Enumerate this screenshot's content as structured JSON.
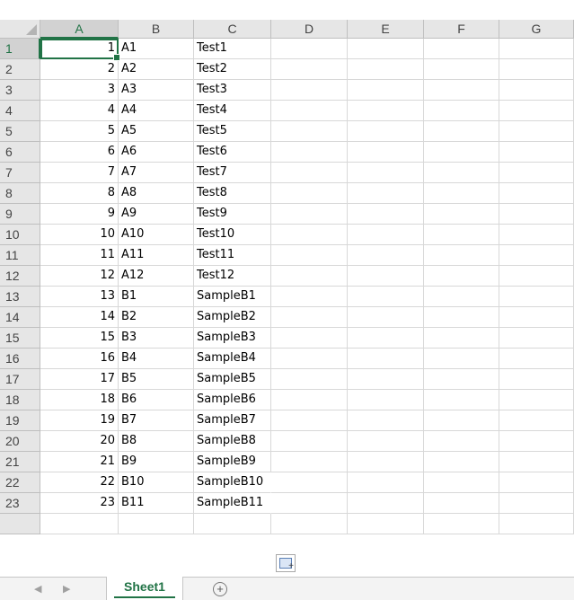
{
  "columns": [
    "A",
    "B",
    "C",
    "D",
    "E",
    "F",
    "G"
  ],
  "active_cell": "A1",
  "rows": [
    {
      "row": "1",
      "a": "1",
      "b": "A1",
      "c": "Test1"
    },
    {
      "row": "2",
      "a": "2",
      "b": "A2",
      "c": "Test2"
    },
    {
      "row": "3",
      "a": "3",
      "b": "A3",
      "c": "Test3"
    },
    {
      "row": "4",
      "a": "4",
      "b": "A4",
      "c": "Test4"
    },
    {
      "row": "5",
      "a": "5",
      "b": "A5",
      "c": "Test5"
    },
    {
      "row": "6",
      "a": "6",
      "b": "A6",
      "c": "Test6"
    },
    {
      "row": "7",
      "a": "7",
      "b": "A7",
      "c": "Test7"
    },
    {
      "row": "8",
      "a": "8",
      "b": "A8",
      "c": "Test8"
    },
    {
      "row": "9",
      "a": "9",
      "b": "A9",
      "c": "Test9"
    },
    {
      "row": "10",
      "a": "10",
      "b": "A10",
      "c": "Test10"
    },
    {
      "row": "11",
      "a": "11",
      "b": "A11",
      "c": "Test11"
    },
    {
      "row": "12",
      "a": "12",
      "b": "A12",
      "c": "Test12"
    },
    {
      "row": "13",
      "a": "13",
      "b": "B1",
      "c": "SampleB1"
    },
    {
      "row": "14",
      "a": "14",
      "b": "B2",
      "c": "SampleB2"
    },
    {
      "row": "15",
      "a": "15",
      "b": "B3",
      "c": "SampleB3"
    },
    {
      "row": "16",
      "a": "16",
      "b": "B4",
      "c": "SampleB4"
    },
    {
      "row": "17",
      "a": "17",
      "b": "B5",
      "c": "SampleB5"
    },
    {
      "row": "18",
      "a": "18",
      "b": "B6",
      "c": "SampleB6"
    },
    {
      "row": "19",
      "a": "19",
      "b": "B7",
      "c": "SampleB7"
    },
    {
      "row": "20",
      "a": "20",
      "b": "B8",
      "c": "SampleB8"
    },
    {
      "row": "21",
      "a": "21",
      "b": "B9",
      "c": "SampleB9"
    },
    {
      "row": "22",
      "a": "22",
      "b": "B10",
      "c": "SampleB10"
    },
    {
      "row": "23",
      "a": "23",
      "b": "B11",
      "c": "SampleB11"
    }
  ],
  "sheet_tabs": [
    "Sheet1"
  ],
  "add_sheet_symbol": "+",
  "nav_left_symbol": "◀",
  "nav_right_symbol": "▶",
  "quick_analysis_icon": "quick-analysis-icon",
  "colors": {
    "accent": "#217346",
    "header_bg": "#e6e6e6",
    "gridline": "#d8d8d8"
  }
}
